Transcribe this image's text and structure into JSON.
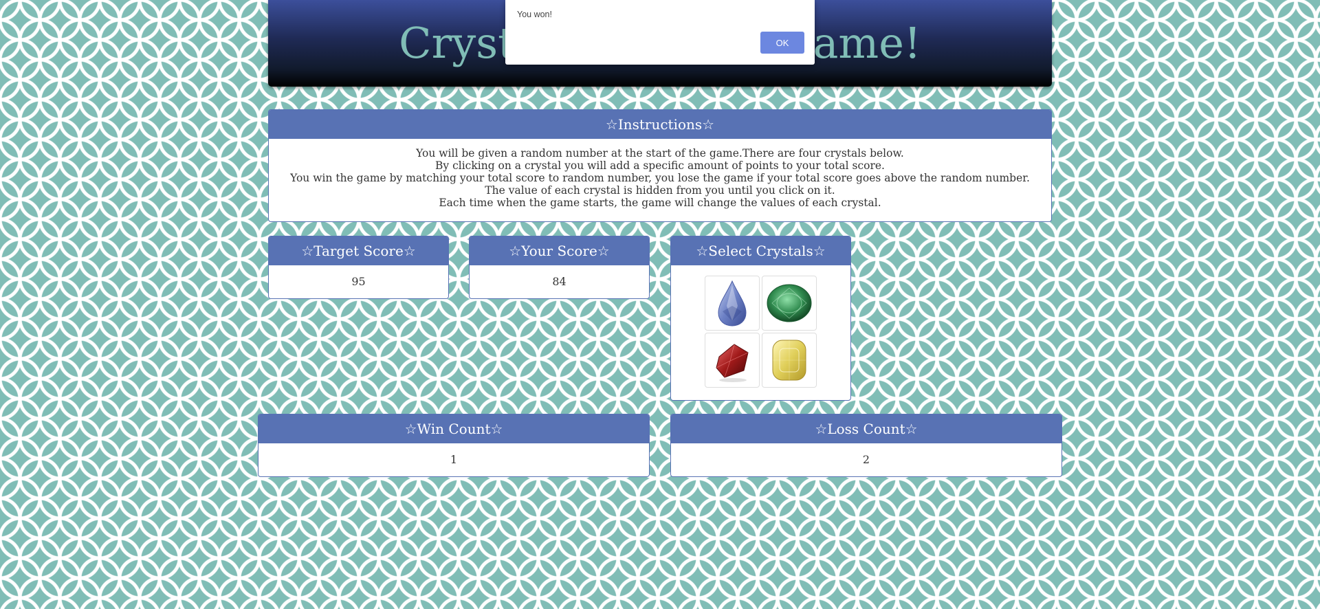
{
  "header": {
    "title": "Crystal Collector Game!"
  },
  "instructions": {
    "heading": "☆Instructions☆",
    "lines": [
      "You will be given a random number at the start of the game.There are four crystals below.",
      "By clicking on a crystal you will add a specific amount of points to your total score.",
      "You win the game by matching your total score to random number, you lose the game if your total score goes above the random number.",
      "The value of each crystal is hidden from you until you click on it.",
      "Each time when the game starts, the game will change the values of each crystal."
    ]
  },
  "target": {
    "heading": "☆Target Score☆",
    "value": "95"
  },
  "your_score": {
    "heading": "☆Your Score☆",
    "value": "84"
  },
  "crystals": {
    "heading": "☆Select Crystals☆",
    "items": [
      {
        "icon": "blue-crystal-icon",
        "color": "#6b7fc4"
      },
      {
        "icon": "green-crystal-icon",
        "color": "#2f8a4e"
      },
      {
        "icon": "red-crystal-icon",
        "color": "#a11a1a"
      },
      {
        "icon": "yellow-crystal-icon",
        "color": "#e0cf5a"
      }
    ]
  },
  "wins": {
    "heading": "☆Win Count☆",
    "value": "1"
  },
  "losses": {
    "heading": "☆Loss Count☆",
    "value": "2"
  },
  "alert": {
    "message": "You won!",
    "ok_label": "OK"
  },
  "colors": {
    "background": "#80bdb6",
    "panel_heading": "#5872b4",
    "alert_button": "#6c87e0"
  }
}
